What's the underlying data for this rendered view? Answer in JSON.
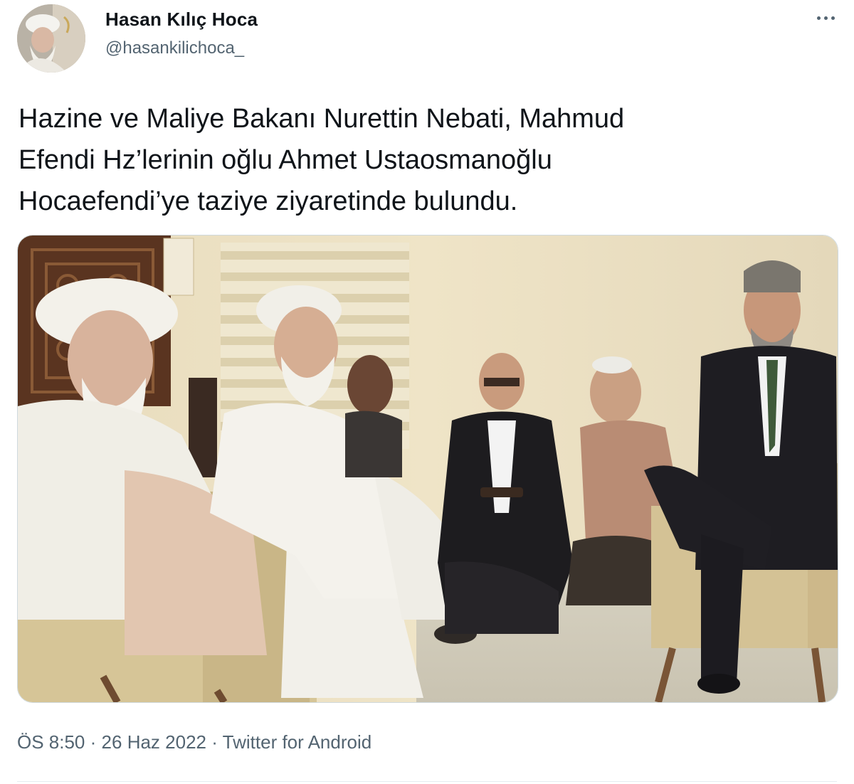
{
  "author": {
    "name": "Hasan Kılıç Hoca",
    "handle": "@hasankilichoca_",
    "avatar_icon": "profile-avatar"
  },
  "more_icon": "more-horizontal-icon",
  "tweet": {
    "text_lines": [
      "Hazine ve Maliye Bakanı Nurettin Nebati, Mahmud",
      "Efendi Hz’lerinin oğlu Ahmet Ustaosmanoğlu",
      "Hocaefendi’ye taziye ziyaretinde bulundu."
    ]
  },
  "media": {
    "description_icon": "tweet-photo"
  },
  "meta": {
    "time": "ÖS 8:50",
    "separator": "·",
    "date": "26 Haz 2022",
    "source": "Twitter for Android"
  },
  "colors": {
    "text": "#0f1419",
    "secondary": "#536471",
    "border": "#cfd9de"
  }
}
